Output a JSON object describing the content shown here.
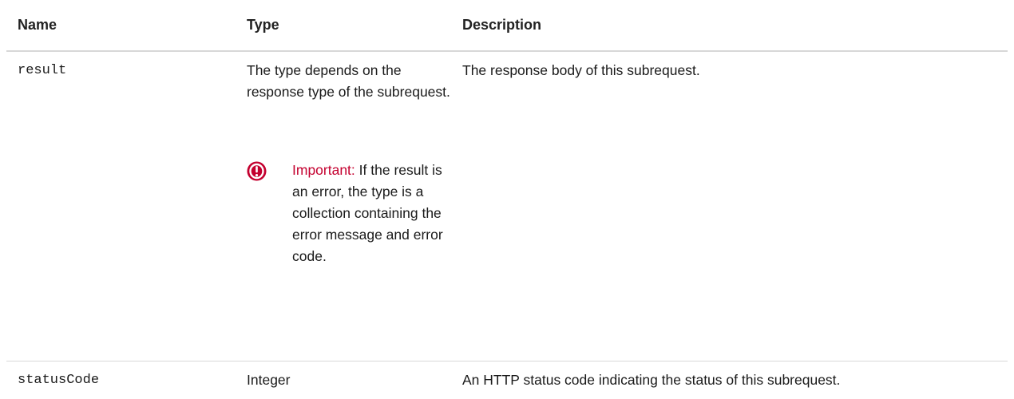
{
  "header": {
    "name": "Name",
    "type": "Type",
    "description": "Description"
  },
  "rows": [
    {
      "name": "result",
      "type": "The type depends on the response type of the subrequest.",
      "description": "The response body of this subrequest.",
      "note": {
        "label": "Important:",
        "text": "If the result is an error, the type is a collection containing the error message and error code.",
        "icon": "important-icon",
        "color": "#c4002f"
      }
    },
    {
      "name": "statusCode",
      "type": "Integer",
      "description": "An HTTP status code indicating the status of this subrequest."
    }
  ]
}
